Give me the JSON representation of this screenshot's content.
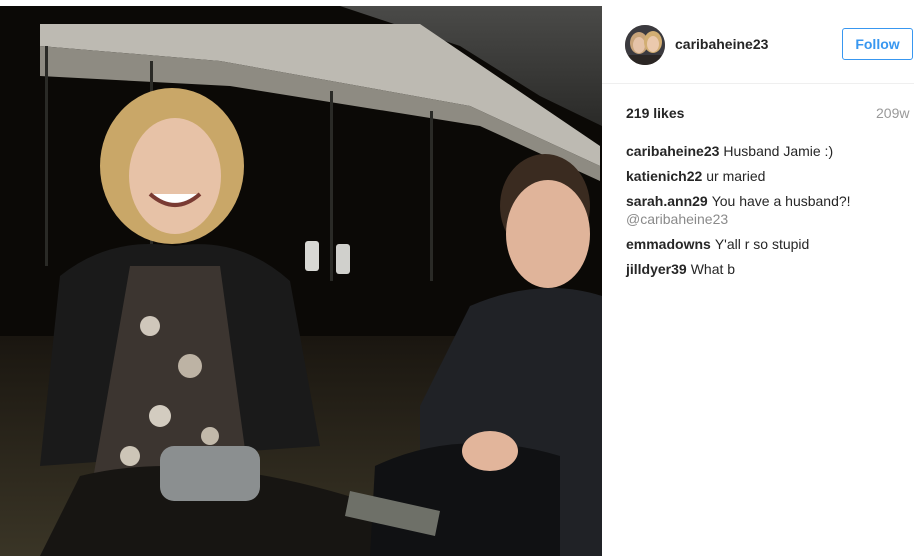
{
  "post": {
    "username": "caribaheine23",
    "follow_label": "Follow",
    "likes": "219 likes",
    "age": "209w"
  },
  "comments": [
    {
      "user": "caribaheine23",
      "text": "Husband Jamie :)"
    },
    {
      "user": "katienich22",
      "text": "ur maried"
    },
    {
      "user": "sarah.ann29",
      "text": "You have a husband?!",
      "mention": "@caribaheine23"
    },
    {
      "user": "emmadowns",
      "text": "Y'all r so stupid"
    },
    {
      "user": "jilldyer39",
      "text": "What b"
    }
  ],
  "colors": {
    "accent": "#3897f0",
    "text": "#262626",
    "muted": "#999999"
  },
  "icons": {
    "avatar": "profile-photo"
  }
}
